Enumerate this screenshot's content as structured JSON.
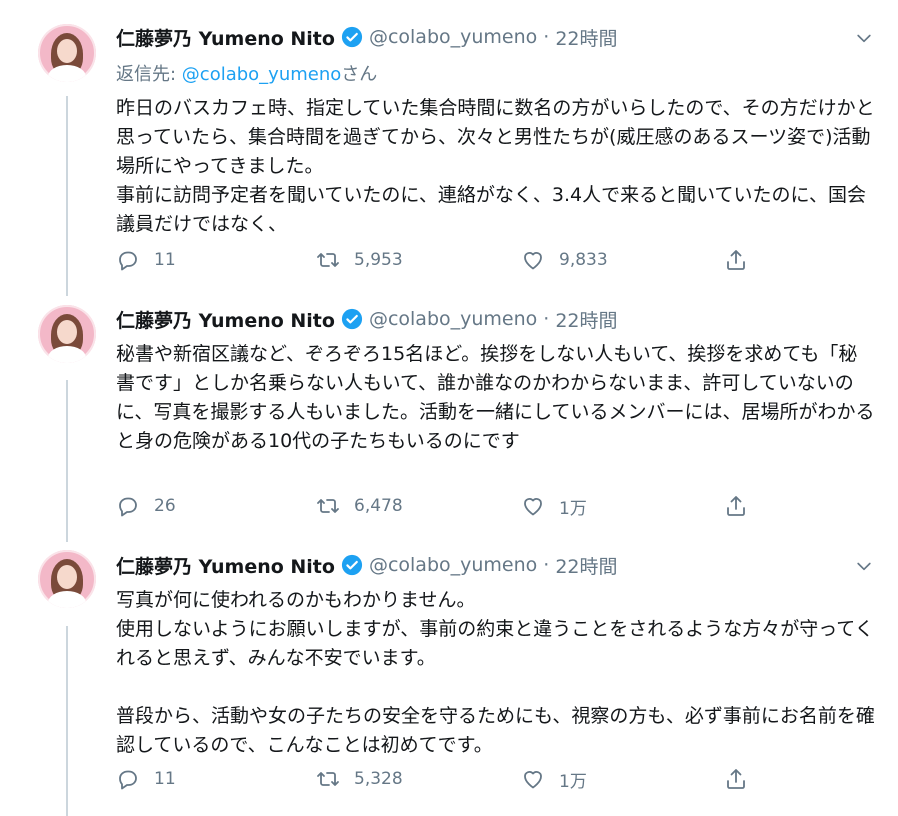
{
  "tweets": [
    {
      "author_name": "仁藤夢乃 Yumeno Nito",
      "handle": "@colabo_yumeno",
      "time": "22時間",
      "reply_prefix": "返信先: ",
      "reply_mention": "@colabo_yumeno",
      "reply_suffix": "さん",
      "text": "昨日のバスカフェ時、指定していた集合時間に数名の方がいらしたので、その方だけかと思っていたら、集合時間を過ぎてから、次々と男性たちが(威圧感のあるスーツ姿で)活動場所にやってきました。\n事前に訪問予定者を聞いていたのに、連絡がなく、3.4人で来ると聞いていたのに、国会議員だけではなく、",
      "replies": "11",
      "retweets": "5,953",
      "likes": "9,833"
    },
    {
      "author_name": "仁藤夢乃 Yumeno Nito",
      "handle": "@colabo_yumeno",
      "time": "22時間",
      "text": "秘書や新宿区議など、ぞろぞろ15名ほど。挨拶をしない人もいて、挨拶を求めても「秘書です」としか名乗らない人もいて、誰か誰なのかわからないまま、許可していないのに、写真を撮影する人もいました。活動を一緒にしているメンバーには、居場所がわかると身の危険がある10代の子たちもいるのにです",
      "replies": "26",
      "retweets": "6,478",
      "likes": "1万"
    },
    {
      "author_name": "仁藤夢乃 Yumeno Nito",
      "handle": "@colabo_yumeno",
      "time": "22時間",
      "text": "写真が何に使われるのかもわかりません。\n使用しないようにお願いしますが、事前の約束と違うことをされるような方々が守ってくれると思えず、みんな不安でいます。\n\n普段から、活動や女の子たちの安全を守るためにも、視察の方も、必ず事前にお名前を確認しているので、こんなことは初めてです。",
      "replies": "11",
      "retweets": "5,328",
      "likes": "1万"
    }
  ],
  "icons": {
    "verified": "verified-badge-icon",
    "reply": "reply-icon",
    "retweet": "retweet-icon",
    "like": "heart-icon",
    "share": "share-icon",
    "more": "chevron-down-icon"
  },
  "colors": {
    "text": "#14171a",
    "muted": "#657786",
    "accent": "#1da1f2",
    "thread_line": "#ccd6dd"
  }
}
